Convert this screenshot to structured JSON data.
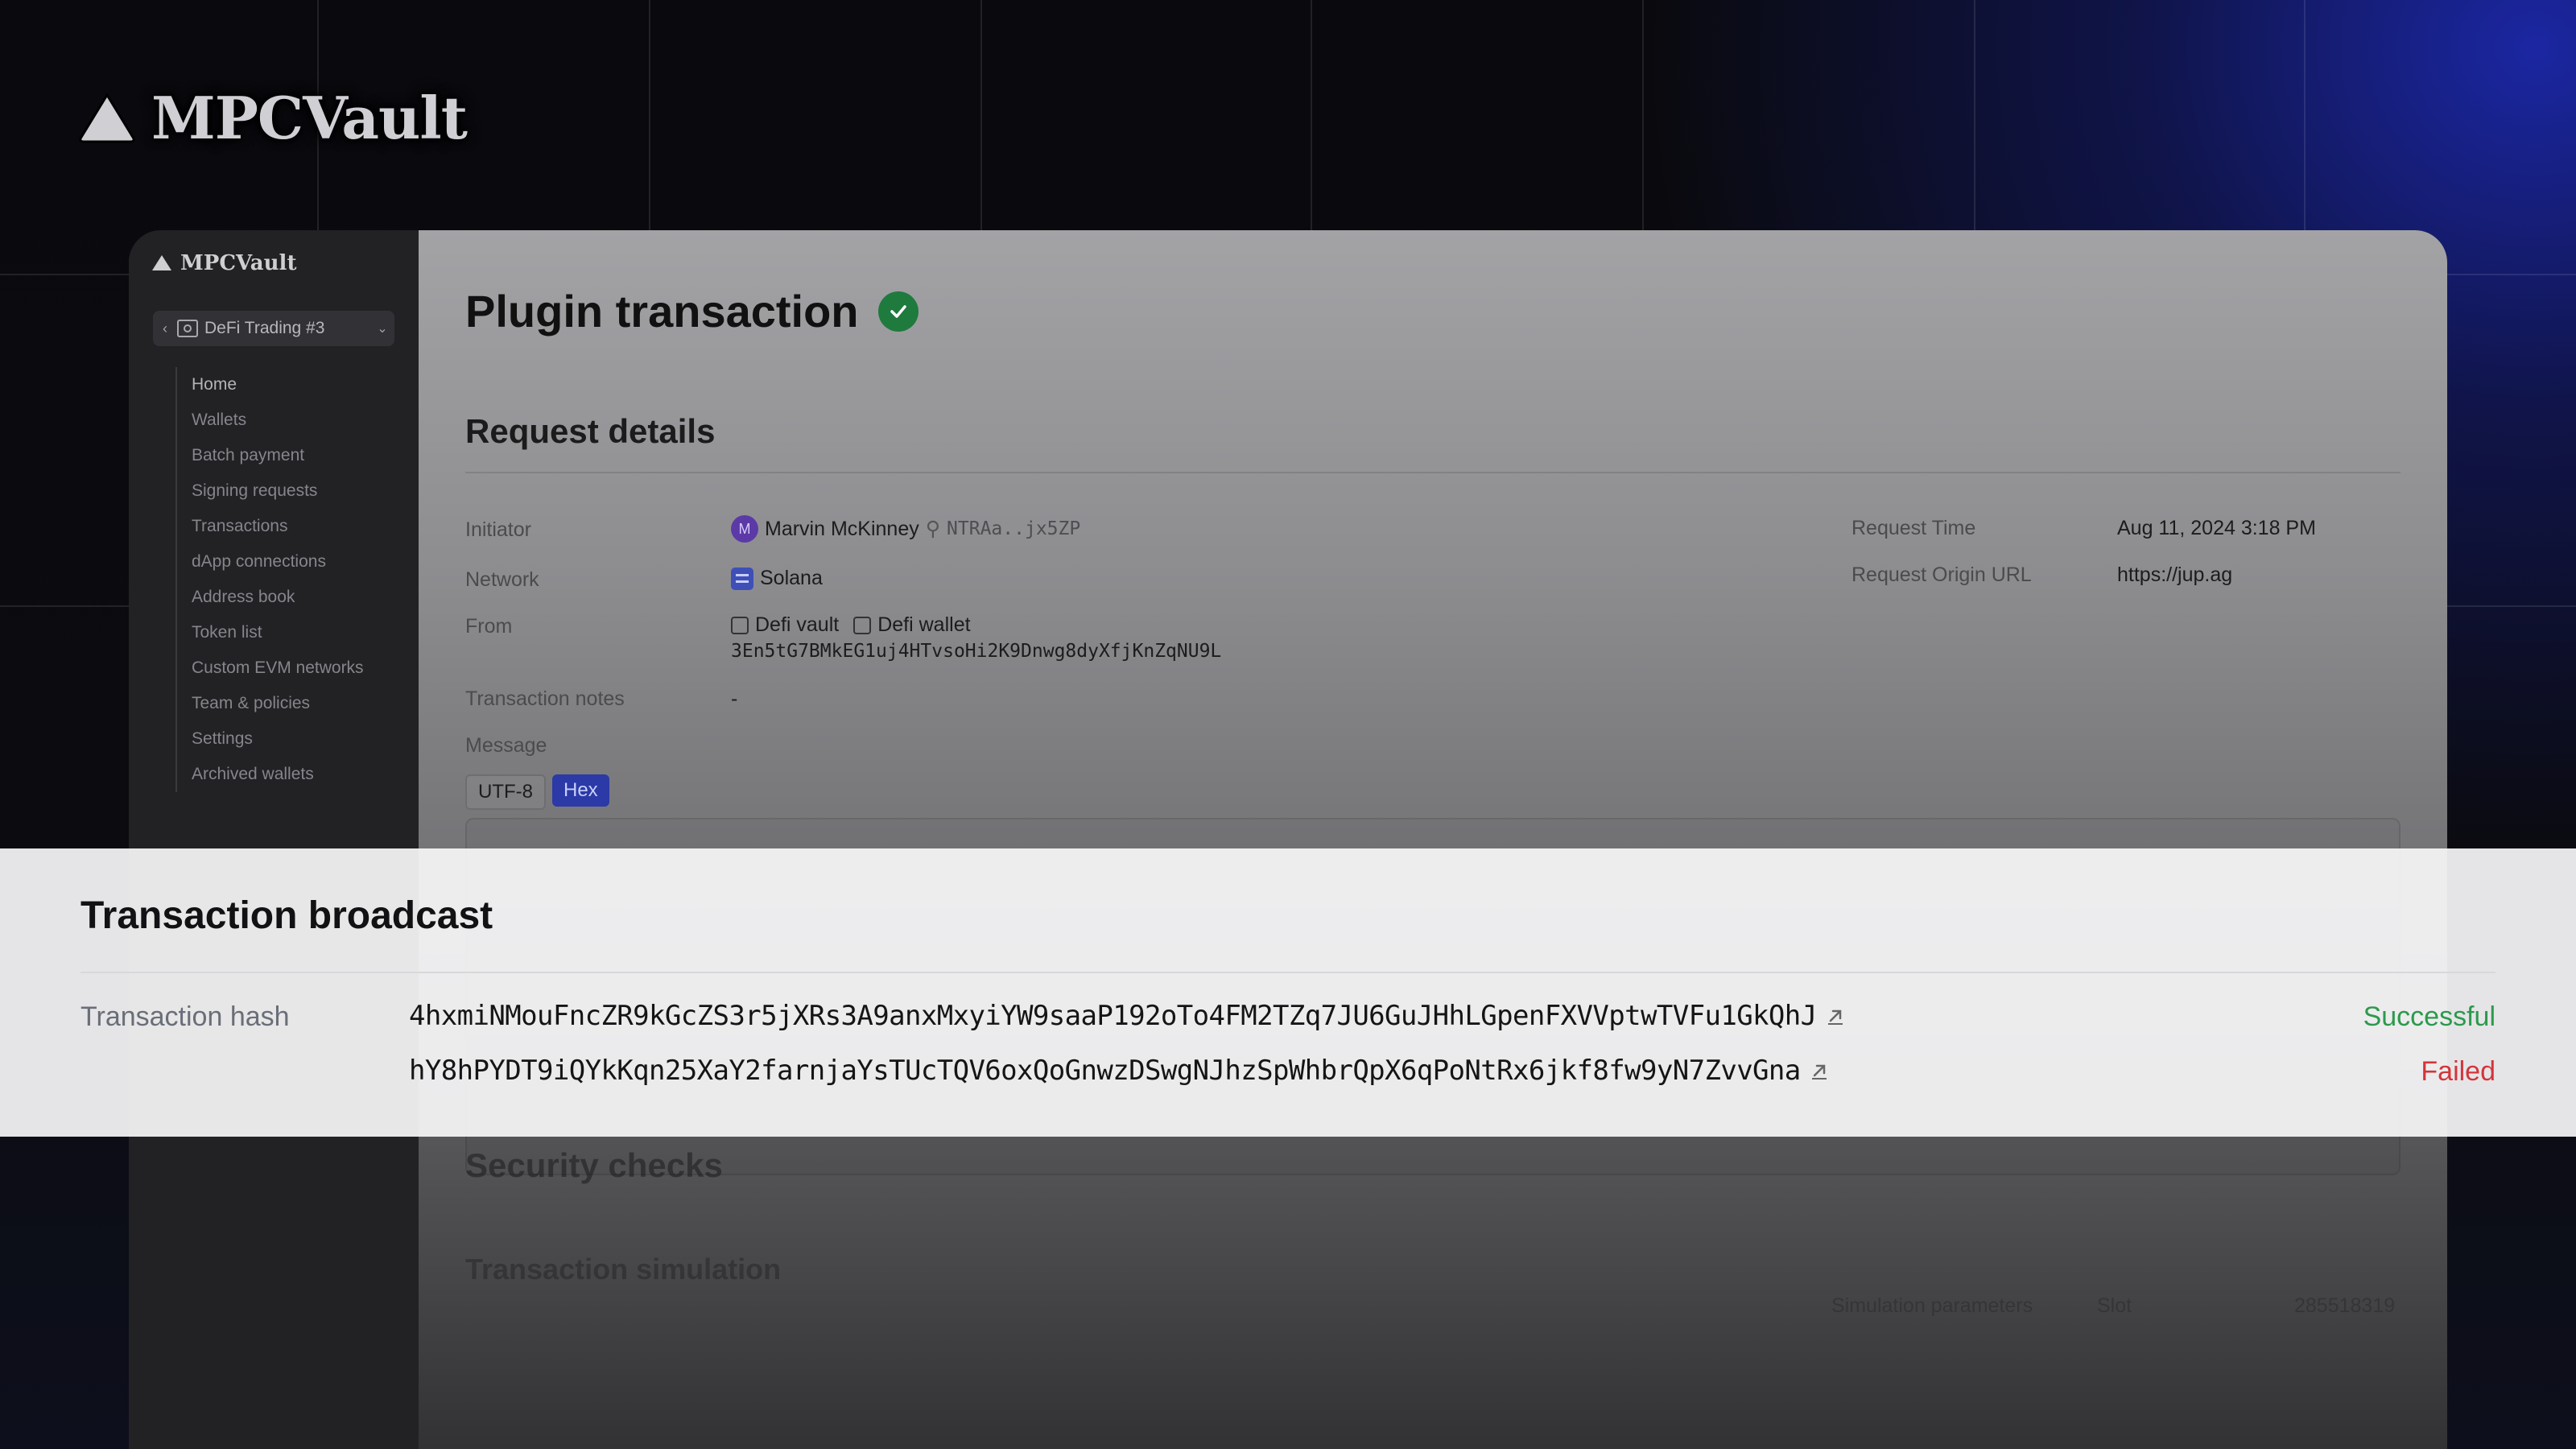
{
  "brand": {
    "name": "MPCVault"
  },
  "sidebar": {
    "logo": "MPCVault",
    "workspace": "DeFi Trading #3",
    "items": [
      {
        "label": "Home"
      },
      {
        "label": "Wallets"
      },
      {
        "label": "Batch payment"
      },
      {
        "label": "Signing requests"
      },
      {
        "label": "Transactions"
      },
      {
        "label": "dApp connections"
      },
      {
        "label": "Address book"
      },
      {
        "label": "Token list"
      },
      {
        "label": "Custom EVM networks"
      },
      {
        "label": "Team & policies"
      },
      {
        "label": "Settings"
      },
      {
        "label": "Archived wallets"
      }
    ]
  },
  "page": {
    "title": "Plugin transaction",
    "status_icon": "check-circle-icon"
  },
  "request": {
    "title": "Request details",
    "initiator_label": "Initiator",
    "initiator_avatar": "M",
    "initiator_name": "Marvin McKinney",
    "initiator_key": "NTRAa..jx5ZP",
    "network_label": "Network",
    "network_value": "Solana",
    "from_label": "From",
    "from_vault": "Defi vault",
    "from_wallet": "Defi wallet",
    "from_address": "3En5tG7BMkEG1uj4HTvsoHi2K9Dnwg8dyXfjKnZqNU9L",
    "notes_label": "Transaction notes",
    "notes_value": "-",
    "message_label": "Message",
    "encoding_utf8": "UTF-8",
    "encoding_hex": "Hex",
    "time_label": "Request Time",
    "time_value": "Aug 11, 2024 3:18 PM",
    "origin_label": "Request Origin URL",
    "origin_value": "https://jup.ag"
  },
  "broadcast": {
    "title": "Transaction broadcast",
    "hash_label": "Transaction hash",
    "rows": [
      {
        "hash": "4hxmiNMouFncZR9kGcZS3r5jXRs3A9anxMxyiYW9saaP192oTo4FM2TZq7JU6GuJHhLGpenFXVVptwTVFu1GkQhJ",
        "status": "Successful"
      },
      {
        "hash": "hY8hPYDT9iQYkKqn25XaY2farnjaYsTUcTQV6oxQoGnwzDSwgNJhzSpWhbrQpX6qPoNtRx6jkf8fw9yN7ZvvGna",
        "status": "Failed"
      }
    ],
    "colors": {
      "success": "#2b9a4c",
      "failed": "#d3353a"
    }
  },
  "security": {
    "title": "Security checks",
    "simulation_title": "Transaction simulation",
    "sim_params_label": "Simulation parameters",
    "slot_label": "Slot",
    "slot_value": "285518319"
  }
}
